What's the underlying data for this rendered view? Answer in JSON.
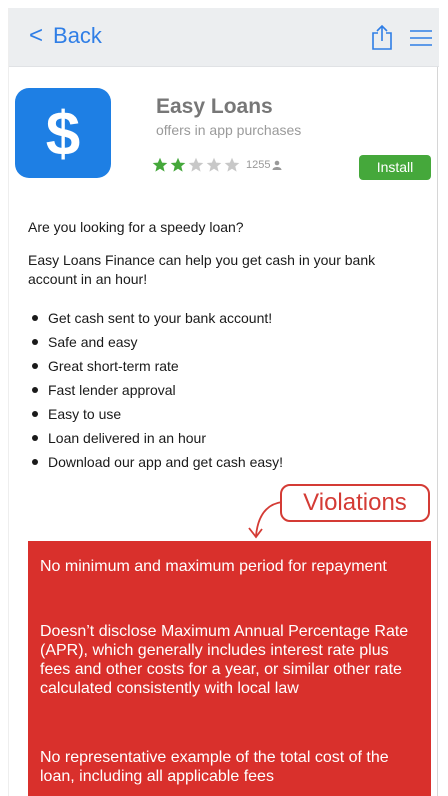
{
  "header": {
    "back_label": "Back"
  },
  "app": {
    "name": "Easy Loans",
    "subtitle": "offers in app purchases",
    "icon_symbol": "$",
    "rating_filled": 2,
    "rating_total": 5,
    "rating_count": "1255",
    "install_label": "Install",
    "icon_color": "#1e7fe4",
    "install_color": "#45a83b"
  },
  "description": {
    "question": "Are you looking for a speedy loan?",
    "paragraph": "Easy Loans Finance can help you get cash in your bank account in an hour!",
    "bullets": [
      "Get cash sent to your bank account!",
      "Safe and easy",
      "Great short-term rate",
      "Fast lender approval",
      "Easy to use",
      "Loan delivered in an hour",
      "Download our app and get cash easy!"
    ]
  },
  "violations": {
    "label": "Violations",
    "color": "#d9302c",
    "items": [
      "No minimum and maximum period for repayment",
      "Doesn’t disclose Maximum Annual Percentage Rate (APR), which generally includes interest rate plus fees and other costs for a year, or similar other rate calculated consistently with local law",
      "No representative example of the total cost of the loan, including all applicable fees"
    ]
  }
}
